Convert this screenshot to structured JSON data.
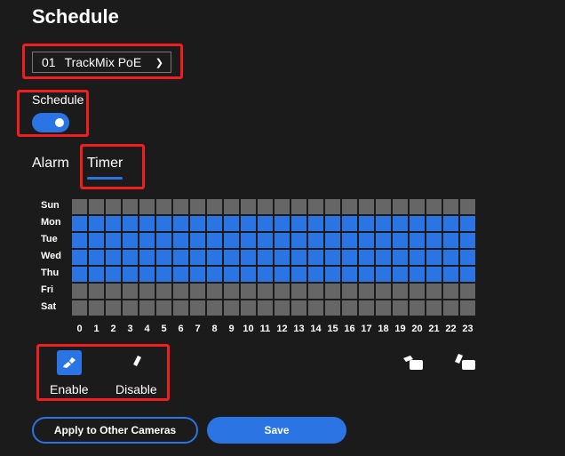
{
  "title": "Schedule",
  "camera_select": {
    "number": "01",
    "name": "TrackMix PoE"
  },
  "schedule_toggle": {
    "label": "Schedule",
    "on": true
  },
  "tabs": [
    {
      "label": "Alarm",
      "active": false
    },
    {
      "label": "Timer",
      "active": true
    }
  ],
  "grid": {
    "days": [
      "Sun",
      "Mon",
      "Tue",
      "Wed",
      "Thu",
      "Fri",
      "Sat"
    ],
    "hours": [
      "0",
      "1",
      "2",
      "3",
      "4",
      "5",
      "6",
      "7",
      "8",
      "9",
      "10",
      "11",
      "12",
      "13",
      "14",
      "15",
      "16",
      "17",
      "18",
      "19",
      "20",
      "21",
      "22",
      "23"
    ],
    "enabled_days": [
      "Mon",
      "Tue",
      "Wed",
      "Thu"
    ],
    "colors": {
      "enabled": "#2a74e4",
      "disabled": "#666666"
    }
  },
  "tools": {
    "enable_label": "Enable",
    "disable_label": "Disable"
  },
  "buttons": {
    "apply": "Apply to Other Cameras",
    "save": "Save"
  },
  "colors": {
    "accent": "#2a74e4",
    "highlight": "#f01e1e",
    "background": "#1b1b1b"
  }
}
